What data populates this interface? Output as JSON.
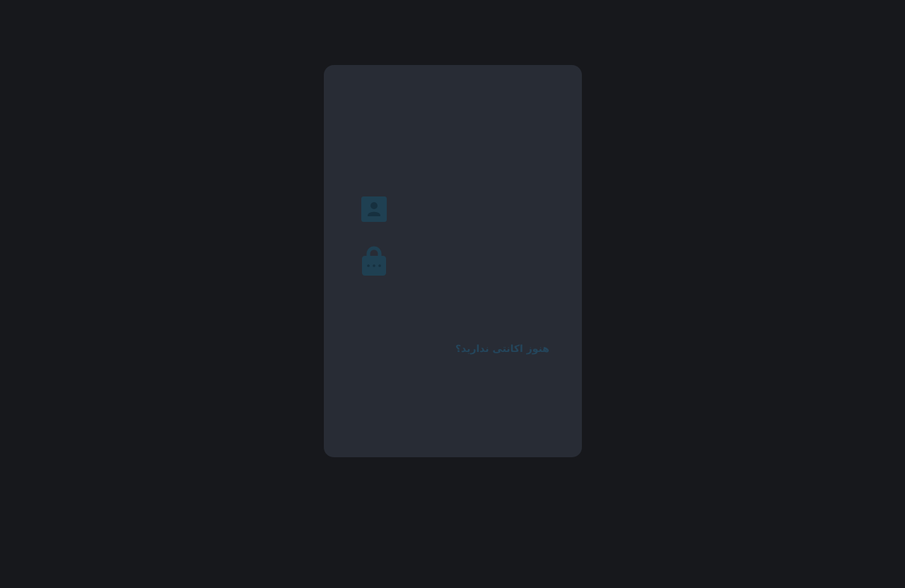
{
  "colors": {
    "page_background": "#17181c",
    "card_background": "#282c35",
    "icon_accent": "#1f4052",
    "link_text": "#24465c"
  },
  "login_form": {
    "username_field": {
      "icon": "user-icon",
      "value": "",
      "placeholder": ""
    },
    "password_field": {
      "icon": "lock-icon",
      "value": "",
      "placeholder": ""
    },
    "signup_prompt": "هنوز اکانتی ندارید؟"
  }
}
